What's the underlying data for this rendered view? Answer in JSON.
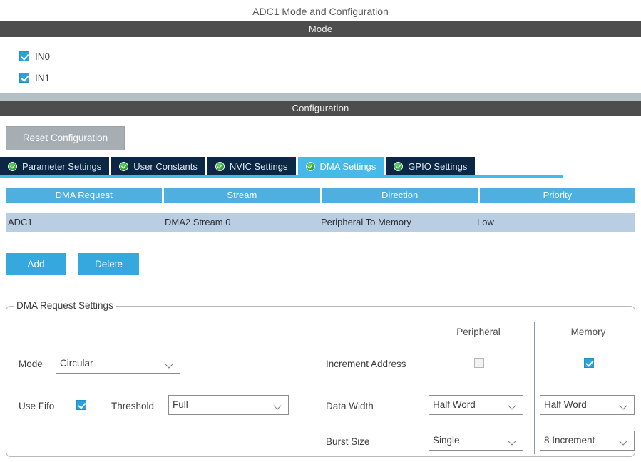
{
  "page_title": "ADC1 Mode and Configuration",
  "sections": {
    "mode": {
      "header": "Mode",
      "checkboxes": [
        {
          "label": "IN0",
          "checked": true
        },
        {
          "label": "IN1",
          "checked": true
        }
      ]
    },
    "configuration": {
      "header": "Configuration",
      "reset_button": "Reset Configuration",
      "tabs": [
        {
          "label": "Parameter Settings",
          "icon": "green-check-icon",
          "active": false
        },
        {
          "label": "User Constants",
          "icon": "green-check-icon",
          "active": false
        },
        {
          "label": "NVIC Settings",
          "icon": "green-check-icon",
          "active": false
        },
        {
          "label": "DMA Settings",
          "icon": "green-check-icon",
          "active": true
        },
        {
          "label": "GPIO Settings",
          "icon": "green-check-icon",
          "active": false
        }
      ]
    }
  },
  "dma_table": {
    "columns": [
      "DMA Request",
      "Stream",
      "Direction",
      "Priority"
    ],
    "rows": [
      {
        "dma_request": "ADC1",
        "stream": "DMA2 Stream 0",
        "direction": "Peripheral To Memory",
        "priority": "Low",
        "selected": true
      }
    ]
  },
  "table_actions": {
    "add": "Add",
    "delete": "Delete"
  },
  "request_settings": {
    "title": "DMA Request Settings",
    "column_headers": {
      "peripheral": "Peripheral",
      "memory": "Memory"
    },
    "mode": {
      "label": "Mode",
      "value": "Circular"
    },
    "increment_address": {
      "label": "Increment Address",
      "peripheral_checked": false,
      "memory_checked": true
    },
    "use_fifo": {
      "label": "Use Fifo",
      "checked": true
    },
    "threshold": {
      "label": "Threshold",
      "value": "Full"
    },
    "data_width": {
      "label": "Data Width",
      "peripheral": "Half Word",
      "memory": "Half Word"
    },
    "burst_size": {
      "label": "Burst Size",
      "peripheral": "Single",
      "memory": "8 Increment"
    }
  },
  "colors": {
    "section_bar": "#4d4d4d",
    "spacer_bar": "#b3c0c6",
    "accent_blue": "#35a8dd",
    "tab_active": "#46b8e9",
    "tab_inactive": "#0c2744",
    "table_header": "#4fb0e0",
    "row_selected": "#bacee3",
    "reset_button": "#a6aeb3",
    "check_green": "#2f9e2f"
  }
}
